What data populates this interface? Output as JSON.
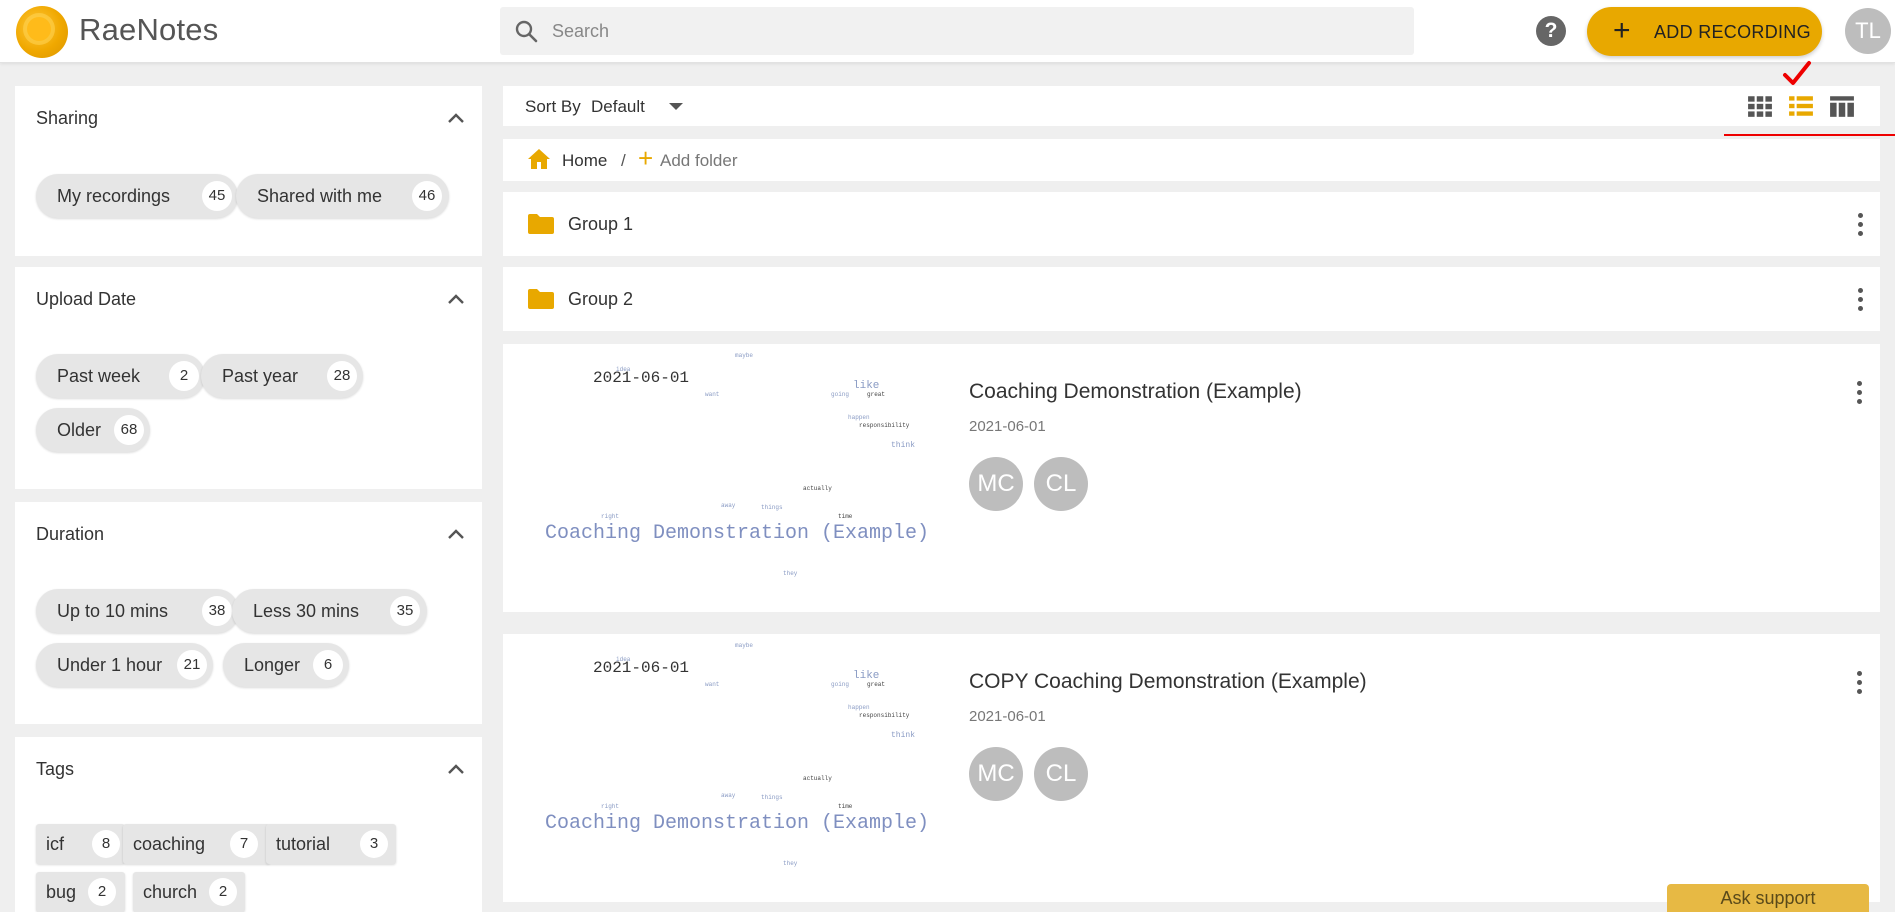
{
  "app": {
    "name": "RaeNotes"
  },
  "header": {
    "search_placeholder": "Search",
    "help_label": "?",
    "add_recording_label": "ADD RECORDING",
    "user_initials": "TL"
  },
  "sidebar": {
    "sharing": {
      "title": "Sharing",
      "chips": [
        {
          "label": "My recordings",
          "count": "45"
        },
        {
          "label": "Shared with me",
          "count": "46"
        }
      ]
    },
    "upload_date": {
      "title": "Upload Date",
      "chips": [
        {
          "label": "Past week",
          "count": "2"
        },
        {
          "label": "Past year",
          "count": "28"
        },
        {
          "label": "Older",
          "count": "68"
        }
      ]
    },
    "duration": {
      "title": "Duration",
      "chips": [
        {
          "label": "Up to 10 mins",
          "count": "38"
        },
        {
          "label": "Less 30 mins",
          "count": "35"
        },
        {
          "label": "Under 1 hour",
          "count": "21"
        },
        {
          "label": "Longer",
          "count": "6"
        }
      ]
    },
    "tags": {
      "title": "Tags",
      "items": [
        {
          "label": "icf",
          "count": "8"
        },
        {
          "label": "coaching",
          "count": "7"
        },
        {
          "label": "tutorial",
          "count": "3"
        },
        {
          "label": "bug",
          "count": "2"
        },
        {
          "label": "church",
          "count": "2"
        }
      ]
    }
  },
  "toolbar": {
    "sort_label": "Sort By",
    "sort_value": "Default",
    "active_view": "list"
  },
  "breadcrumb": {
    "home": "Home",
    "separator": "/",
    "add_folder": "Add folder"
  },
  "folders": [
    {
      "name": "Group 1"
    },
    {
      "name": "Group 2"
    }
  ],
  "recordings": [
    {
      "title": "Coaching Demonstration (Example)",
      "date": "2021-06-01",
      "thumb_date": "2021-06-01",
      "thumb_title": "Coaching Demonstration (Example)",
      "participants": [
        "MC",
        "CL"
      ]
    },
    {
      "title": "COPY Coaching Demonstration (Example)",
      "date": "2021-06-01",
      "thumb_date": "2021-06-01",
      "thumb_title": "Coaching Demonstration (Example)",
      "participants": [
        "MC",
        "CL"
      ]
    }
  ],
  "word_cloud": [
    "maybe",
    "idea",
    "like",
    "great",
    "going",
    "want",
    "actually",
    "responsibility",
    "think",
    "happen",
    "things",
    "away",
    "time",
    "right",
    "they"
  ],
  "support": {
    "label": "Ask support"
  },
  "colors": {
    "accent": "#e8a800",
    "marker": "#e00000"
  }
}
